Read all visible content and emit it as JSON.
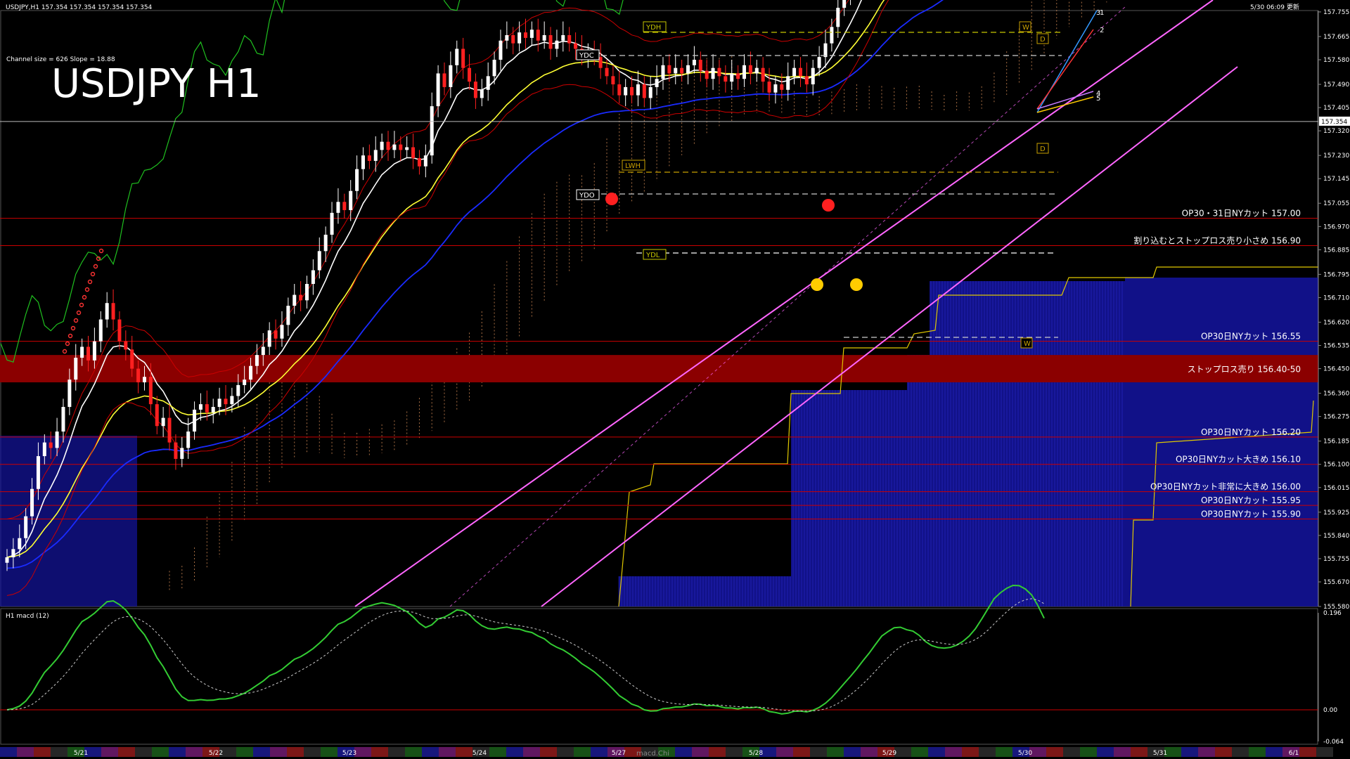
{
  "header": {
    "symbol_info": "USDJPY,H1  157.354 157.354 157.354 157.354",
    "server_time": "5/30 06:09 更新"
  },
  "title": "USDJPY H1",
  "channel_info": "Channel size = 626 Slope = 18.88",
  "current_price_label": "157.354",
  "macd_label": "H1  macd (12)",
  "macd_watermark": "macd.Chi",
  "colors": {
    "background": "#000000",
    "ema_white": "#ffffff",
    "ema_yellow": "#ffff33",
    "ema_blue": "#1a2bff",
    "green_line": "#1fbf1f",
    "channel": "#ff66ff",
    "red_level": "#cc0000",
    "band": "#8b0000",
    "blue_hist": "#1414a0",
    "yellow_step": "#e0c800",
    "bull": "#ffffff",
    "bear": "#ff2020"
  },
  "chart_data": {
    "type": "candlestick",
    "symbol": "USDJPY",
    "timeframe": "H1",
    "y_axis": {
      "ticks": [
        "157.755",
        "157.665",
        "157.580",
        "157.490",
        "157.405",
        "157.320",
        "157.230",
        "157.145",
        "157.055",
        "156.970",
        "156.885",
        "156.795",
        "156.710",
        "156.620",
        "156.535",
        "156.450",
        "156.360",
        "156.275",
        "156.185",
        "156.100",
        "156.015",
        "155.925",
        "155.840",
        "155.755",
        "155.670",
        "155.580"
      ],
      "range": [
        155.58,
        157.76
      ]
    },
    "x_axis": {
      "dates": [
        "5/21",
        "5/22",
        "5/23",
        "5/24",
        "5/27",
        "5/28",
        "5/29",
        "5/30",
        "5/31",
        "6/1"
      ]
    },
    "levels": [
      {
        "price": 157.0,
        "label": "OP30・31日NYカット 157.00"
      },
      {
        "price": 156.9,
        "label": "割り込むとストップロス売り小さめ 156.90"
      },
      {
        "price": 156.55,
        "label": "OP30日NYカット 156.55"
      },
      {
        "price": 156.2,
        "label": "OP30日NYカット 156.20"
      },
      {
        "price": 156.1,
        "label": "OP30日NYカット大きめ 156.10"
      },
      {
        "price": 156.0,
        "label": "OP30日NYカット非常に大きめ 156.00"
      },
      {
        "price": 155.95,
        "label": "OP30日NYカット 155.95"
      },
      {
        "price": 155.9,
        "label": "OP30日NYカット 155.90"
      }
    ],
    "band": {
      "from": 156.4,
      "to": 156.5,
      "label": "ストップロス売り 156.40-50"
    },
    "markers": [
      "YDH",
      "YDC",
      "YDO",
      "YDL",
      "LWH",
      "W",
      "W",
      "D",
      "D",
      "1",
      "2",
      "3",
      "4",
      "5"
    ],
    "candles": {
      "start": 155.74,
      "deltas": [
        0.02,
        0.03,
        0.04,
        0.08,
        0.1,
        0.12,
        0.05,
        -0.02,
        0.06,
        0.09,
        0.1,
        0.08,
        0.04,
        -0.05,
        0.07,
        0.08,
        0.06,
        -0.06,
        -0.08,
        -0.03,
        -0.07,
        -0.05,
        0.02,
        -0.1,
        -0.08,
        0.03,
        -0.09,
        -0.06,
        0.04,
        0.06,
        0.08,
        0.02,
        -0.03,
        0.02,
        0.03,
        -0.02,
        0.03,
        0.04,
        0.02,
        0.05,
        0.04,
        0.03,
        0.06,
        -0.03,
        0.05,
        0.07,
        0.04,
        -0.02,
        0.06,
        0.05,
        0.07,
        0.06,
        0.08,
        0.04,
        -0.03,
        0.07,
        0.08,
        0.05,
        -0.02,
        0.04,
        0.03,
        -0.03,
        0.02,
        -0.02,
        0.01,
        -0.04,
        -0.03,
        0.04,
        0.18,
        0.12,
        -0.05,
        0.08,
        0.06,
        -0.07,
        -0.05,
        -0.06,
        0.03,
        0.05,
        0.06,
        0.07,
        0.02,
        -0.03,
        0.04,
        -0.02,
        0.03,
        -0.04,
        0.02,
        -0.05,
        0.03,
        0.02,
        -0.03,
        -0.02,
        -0.03,
        0.02,
        -0.02,
        -0.04,
        -0.03,
        -0.03,
        -0.04,
        0.03,
        -0.03,
        0.04,
        -0.05,
        0.04,
        0.03,
        0.05,
        -0.03,
        0.02,
        -0.02,
        0.03,
        0.02,
        -0.04,
        -0.03,
        0.04,
        -0.03,
        -0.02,
        0.03,
        -0.02,
        0.05,
        -0.03,
        0.02,
        -0.05,
        -0.04,
        0.03,
        -0.02,
        0.05,
        0.03,
        -0.03,
        -0.03,
        0.06,
        0.04,
        0.05,
        0.06,
        0.07,
        0.05,
        0.04,
        0.06,
        0.07,
        0.05,
        0.08,
        0.06,
        -0.03,
        0.03,
        -0.04,
        -0.05,
        0.04,
        -0.06,
        -0.05,
        0.04,
        0.05,
        0.04,
        0.05,
        0.06,
        0.07,
        0.08,
        0.1,
        0.12,
        0.1,
        0.08,
        -0.02,
        0.03,
        0.02,
        -0.03,
        -0.04,
        -0.05,
        -0.12,
        -0.08
      ]
    },
    "macd": {
      "y_ticks": [
        "0.196",
        "0.00",
        "-0.064"
      ],
      "range": [
        -0.064,
        0.196
      ]
    }
  }
}
